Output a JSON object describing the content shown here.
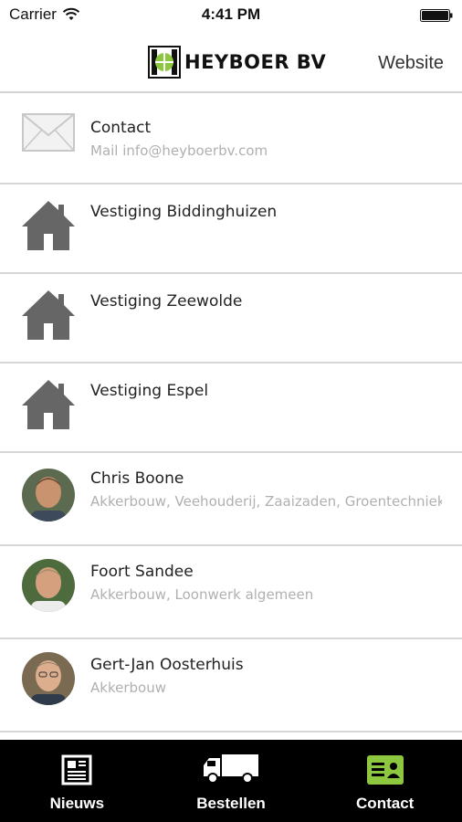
{
  "status_bar": {
    "carrier": "Carrier",
    "time": "4:41 PM"
  },
  "header": {
    "logo_text": "HEYBOER BV",
    "website_label": "Website"
  },
  "list": {
    "contact": {
      "title": "Contact",
      "subtitle": "Mail info@heyboerbv.com",
      "icon": "mail-icon"
    },
    "locations": [
      {
        "title": "Vestiging Biddinghuizen",
        "icon": "house-icon"
      },
      {
        "title": "Vestiging Zeewolde",
        "icon": "house-icon"
      },
      {
        "title": "Vestiging Espel",
        "icon": "house-icon"
      }
    ],
    "people": [
      {
        "name": "Chris Boone",
        "roles": "Akkerbouw, Veehouderij, Zaaizaden, Groentechnieken"
      },
      {
        "name": "Foort Sandee",
        "roles": "Akkerbouw, Loonwerk algemeen"
      },
      {
        "name": "Gert-Jan Oosterhuis",
        "roles": "Akkerbouw"
      }
    ]
  },
  "tab_bar": {
    "tabs": [
      {
        "label": "Nieuws",
        "icon": "newspaper-icon"
      },
      {
        "label": "Bestellen",
        "icon": "truck-icon"
      },
      {
        "label": "Contact",
        "icon": "contact-card-icon",
        "active": true
      }
    ]
  },
  "colors": {
    "brand_green": "#8dc63f",
    "tab_active": "#8dc63f",
    "subtitle_gray": "#b0b0b0",
    "icon_gray": "#666666"
  }
}
